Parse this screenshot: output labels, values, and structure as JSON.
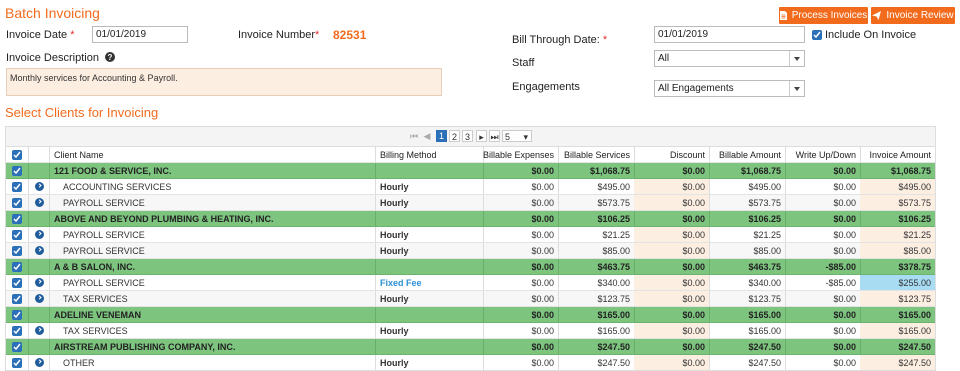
{
  "page": {
    "title": "Batch Invoicing",
    "buttons": {
      "process": "Process Invoices",
      "review": "Invoice Review"
    }
  },
  "form": {
    "invoice_date": {
      "label": "Invoice Date",
      "required_mark": "*",
      "value": "01/01/2019"
    },
    "invoice_number": {
      "label": "Invoice Number",
      "required_mark": "*",
      "value": "82531"
    },
    "bill_through": {
      "label": "Bill Through Date:",
      "required_mark": "*",
      "value": "01/01/2019"
    },
    "include_on_invoice": {
      "label": "Include On Invoice",
      "checked": true
    },
    "description": {
      "label": "Invoice Description",
      "value": "Monthly services for Accounting & Payroll."
    },
    "staff": {
      "label": "Staff",
      "value": "All"
    },
    "engagements": {
      "label": "Engagements",
      "value": "All Engagements"
    }
  },
  "section_title": "Select Clients for Invoicing",
  "pager": {
    "pages": [
      "1",
      "2",
      "3"
    ],
    "current": "1",
    "page_size": "5"
  },
  "table": {
    "columns": [
      "Client Name",
      "Billing Method",
      "Billable Expenses",
      "Billable Services",
      "Discount",
      "Billable Amount",
      "Write Up/Down",
      "Invoice Amount"
    ],
    "rows": [
      {
        "type": "group",
        "name": "121 FOOD & SERVICE, INC.",
        "method": "",
        "expenses": "$0.00",
        "services": "$1,068.75",
        "discount": "$0.00",
        "amount": "$1,068.75",
        "writeup": "$0.00",
        "invoice": "$1,068.75"
      },
      {
        "type": "item",
        "name": "ACCOUNTING SERVICES",
        "method": "Hourly",
        "expenses": "$0.00",
        "services": "$495.00",
        "discount": "$0.00",
        "amount": "$495.00",
        "writeup": "$0.00",
        "invoice": "$495.00"
      },
      {
        "type": "item",
        "name": "PAYROLL SERVICE",
        "method": "Hourly",
        "expenses": "$0.00",
        "services": "$573.75",
        "discount": "$0.00",
        "amount": "$573.75",
        "writeup": "$0.00",
        "invoice": "$573.75"
      },
      {
        "type": "group",
        "name": "ABOVE AND BEYOND PLUMBING & HEATING, INC.",
        "method": "",
        "expenses": "$0.00",
        "services": "$106.25",
        "discount": "$0.00",
        "amount": "$106.25",
        "writeup": "$0.00",
        "invoice": "$106.25"
      },
      {
        "type": "item",
        "name": "PAYROLL SERVICE",
        "method": "Hourly",
        "expenses": "$0.00",
        "services": "$21.25",
        "discount": "$0.00",
        "amount": "$21.25",
        "writeup": "$0.00",
        "invoice": "$21.25"
      },
      {
        "type": "item",
        "name": "PAYROLL SERVICE",
        "method": "Hourly",
        "expenses": "$0.00",
        "services": "$85.00",
        "discount": "$0.00",
        "amount": "$85.00",
        "writeup": "$0.00",
        "invoice": "$85.00"
      },
      {
        "type": "group",
        "name": "A & B SALON, INC.",
        "method": "",
        "expenses": "$0.00",
        "services": "$463.75",
        "discount": "$0.00",
        "amount": "$463.75",
        "writeup": "-$85.00",
        "invoice": "$378.75"
      },
      {
        "type": "item",
        "name": "PAYROLL SERVICE",
        "method": "Fixed Fee",
        "expenses": "$0.00",
        "services": "$340.00",
        "discount": "$0.00",
        "amount": "$340.00",
        "writeup": "-$85.00",
        "invoice": "$255.00",
        "highlight": true
      },
      {
        "type": "item",
        "name": "TAX SERVICES",
        "method": "Hourly",
        "expenses": "$0.00",
        "services": "$123.75",
        "discount": "$0.00",
        "amount": "$123.75",
        "writeup": "$0.00",
        "invoice": "$123.75"
      },
      {
        "type": "group",
        "name": "ADELINE VENEMAN",
        "method": "",
        "expenses": "$0.00",
        "services": "$165.00",
        "discount": "$0.00",
        "amount": "$165.00",
        "writeup": "$0.00",
        "invoice": "$165.00"
      },
      {
        "type": "item",
        "name": "TAX SERVICES",
        "method": "Hourly",
        "expenses": "$0.00",
        "services": "$165.00",
        "discount": "$0.00",
        "amount": "$165.00",
        "writeup": "$0.00",
        "invoice": "$165.00"
      },
      {
        "type": "group",
        "name": "AIRSTREAM PUBLISHING COMPANY, INC.",
        "method": "",
        "expenses": "$0.00",
        "services": "$247.50",
        "discount": "$0.00",
        "amount": "$247.50",
        "writeup": "$0.00",
        "invoice": "$247.50"
      },
      {
        "type": "item",
        "name": "OTHER",
        "method": "Hourly",
        "expenses": "$0.00",
        "services": "$247.50",
        "discount": "$0.00",
        "amount": "$247.50",
        "writeup": "$0.00",
        "invoice": "$247.50"
      }
    ]
  },
  "colors": {
    "accent": "#f26b1d",
    "group_row": "#7dc47f",
    "checkbox": "#2a6fb8",
    "editable_cell": "#fdeee2",
    "highlight_cell": "#a8dcf3",
    "link": "#2b8fd6"
  }
}
